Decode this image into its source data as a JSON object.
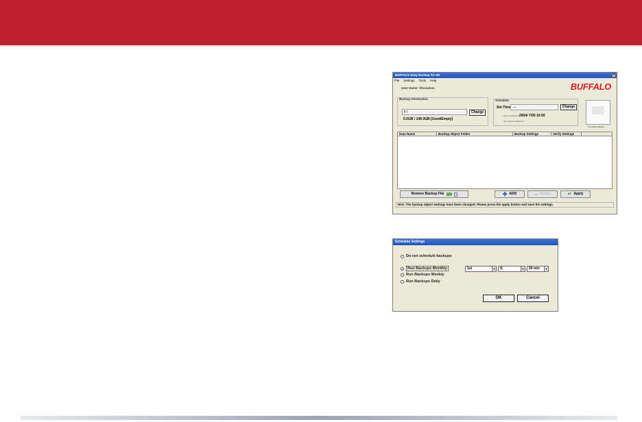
{
  "banner": {
    "color": "#c0202c"
  },
  "backup_window": {
    "title": "BUFFALO Easy Backup for HD",
    "close_glyph": "×",
    "menu": [
      "File",
      "Settings",
      "Tools",
      "Help"
    ],
    "username": "User Name: Shuvaleva",
    "logo": "BUFFALO",
    "destination": {
      "label": "Backup Destination",
      "drive": "F:\\",
      "capacity": "0.0GB / 149.0GB  [Used/Empty]",
      "change_label": "Change"
    },
    "schedule": {
      "label": "Schedule",
      "set_time_label": "Set Time :",
      "set_time_value": "—",
      "next_label": "Next Last Backup",
      "next_value": "2004/ 7/05 10:50",
      "next_selected_label": "Next Selected Backup :",
      "change_label": "Change"
    },
    "immediate_backup_label": "Immediate Backup",
    "table_headers": [
      "Data Name",
      "Backup Object Folder",
      "Backup Settings",
      "Verify Settings"
    ],
    "buttons": {
      "restore": "Restore Backup File",
      "add": "ADD",
      "delete": "Delete",
      "apply": "Apply"
    },
    "status": "Hint: The backup object settings have been changed. Please press the apply button and save the settings."
  },
  "schedule_dialog": {
    "title": "Schedule Settings",
    "options": [
      "Do not schedule backups",
      "Run Backups Monthly",
      "Run Backups Weekly",
      "Run Backups Daily"
    ],
    "selected_option_index": 1,
    "day_value": "1st",
    "hour_value": "9:",
    "minute_value": "00 min",
    "ok_label": "OK",
    "cancel_label": "Cancel"
  }
}
